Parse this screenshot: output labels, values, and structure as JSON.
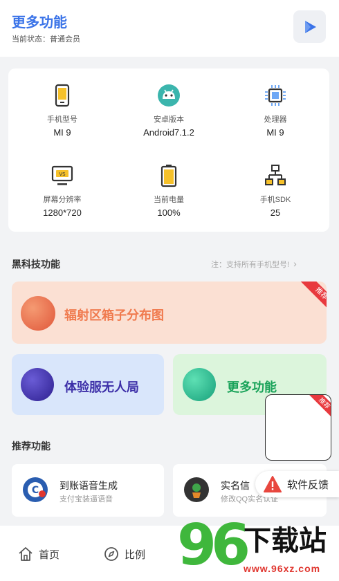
{
  "header": {
    "title": "更多功能",
    "status": "当前状态：普通会员"
  },
  "device_info": [
    {
      "icon": "phone-icon",
      "label": "手机型号",
      "value": "MI 9"
    },
    {
      "icon": "android-icon",
      "label": "安卓版本",
      "value": "Android7.1.2"
    },
    {
      "icon": "cpu-icon",
      "label": "处理器",
      "value": "MI 9"
    },
    {
      "icon": "monitor-icon",
      "label": "屏幕分辨率",
      "value": "1280*720"
    },
    {
      "icon": "battery-icon",
      "label": "当前电量",
      "value": "100%"
    },
    {
      "icon": "network-icon",
      "label": "手机SDK",
      "value": "25"
    }
  ],
  "blacktech": {
    "title": "黑科技功能",
    "note": "注：支持所有手机型号!",
    "items": [
      {
        "label": "辐射区箱子分布图",
        "badge": "推荐",
        "color": "#f07a4e"
      },
      {
        "label": "体验服无人局",
        "color": "#3d2fa8"
      },
      {
        "label": "更多功能",
        "color": "#1aa35a"
      }
    ]
  },
  "recommend": {
    "title": "推荐功能",
    "items": [
      {
        "title": "到账语音生成",
        "subtitle": "支付宝装逼语音"
      },
      {
        "title": "实名信",
        "subtitle": "修改QQ实名认证"
      }
    ]
  },
  "floating": {
    "badge": "推荐"
  },
  "feedback": {
    "label": "软件反馈"
  },
  "nav": [
    {
      "icon": "home-icon",
      "label": "首页"
    },
    {
      "icon": "compass-icon",
      "label": "比例"
    }
  ],
  "watermark": {
    "number": "96",
    "text": "下载站",
    "url": "www.96xz.com"
  }
}
